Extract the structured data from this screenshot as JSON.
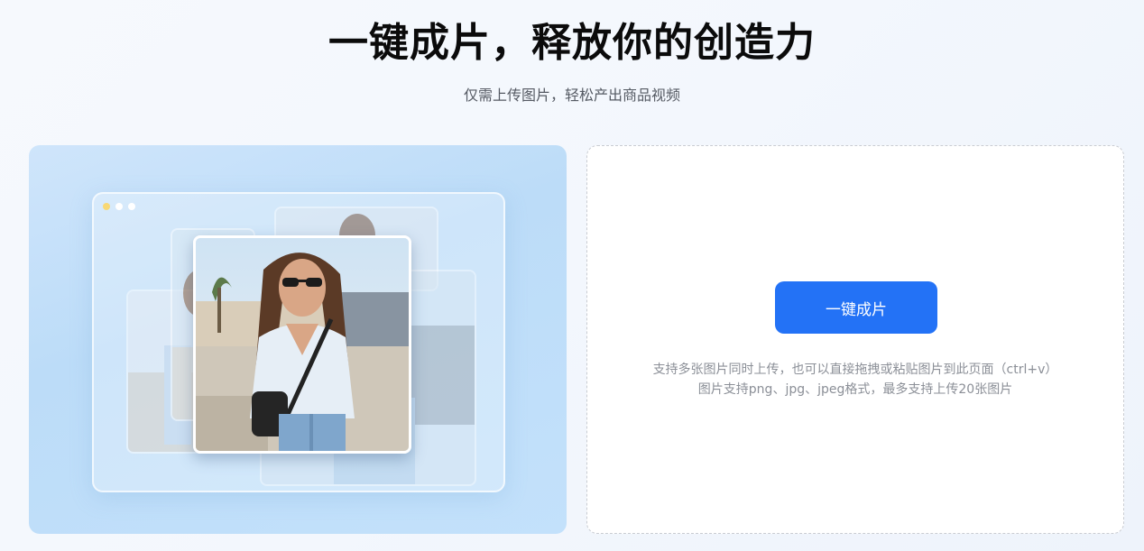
{
  "header": {
    "title": "一键成片，释放你的创造力",
    "subtitle": "仅需上传图片，轻松产出商品视频"
  },
  "preview": {
    "window_dots": [
      "#f8d874",
      "#ffffff",
      "#ffffff"
    ],
    "image_icon": "fashion-photo-image"
  },
  "upload": {
    "button_label": "一键成片",
    "hint_line1": "支持多张图片同时上传，也可以直接拖拽或粘贴图片到此页面（ctrl+v）",
    "hint_line2": "图片支持png、jpg、jpeg格式，最多支持上传20张图片"
  },
  "colors": {
    "accent": "#2372f6",
    "panel_blue": "#bcdcf8"
  }
}
